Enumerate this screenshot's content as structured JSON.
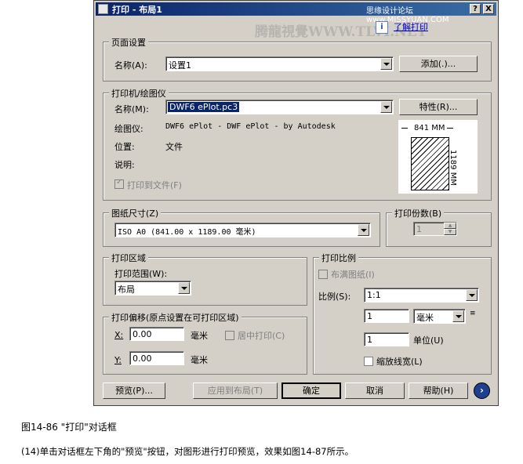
{
  "window": {
    "title": "打印 - 布局1",
    "watermark_top": "思缘设计论坛 www.MISSYUAN.COM",
    "watermark_mid": "腾龍視覺WWW.TLVI.NET",
    "help_button": "?",
    "close_button": "X",
    "learn_link": "了解打印"
  },
  "page_setup": {
    "group_label": "页面设置",
    "name_label": "名称(A):",
    "name_value": "设置1",
    "add_button": "添加(.)..."
  },
  "printer": {
    "group_label": "打印机/绘图仪",
    "name_label": "名称(M):",
    "name_value": "DWF6 ePlot.pc3",
    "properties_button": "特性(R)...",
    "plotter_label": "绘图仪:",
    "plotter_value": "DWF6 ePlot - DWF ePlot - by Autodesk",
    "location_label": "位置:",
    "location_value": "文件",
    "description_label": "说明:",
    "print_to_file_label": "打印到文件(F)",
    "preview_width": "841 MM",
    "preview_height": "1189 MM"
  },
  "paper": {
    "group_label": "图纸尺寸(Z)",
    "size_value": "ISO A0 (841.00 x 1189.00 毫米)"
  },
  "copies": {
    "group_label": "打印份数(B)",
    "value": "1"
  },
  "plot_area": {
    "group_label": "打印区域",
    "range_label": "打印范围(W):",
    "range_value": "布局"
  },
  "plot_scale": {
    "group_label": "打印比例",
    "fit_paper_label": "布满图纸(I)",
    "scale_label": "比例(S):",
    "scale_value": "1:1",
    "value1": "1",
    "unit1_value": "毫米",
    "value2": "1",
    "unit2_label": "单位(U)",
    "lineweight_label": "缩放线宽(L)"
  },
  "plot_offset": {
    "group_label": "打印偏移(原点设置在可打印区域)",
    "x_label": "X:",
    "x_value": "0.00",
    "x_unit": "毫米",
    "center_label": "居中打印(C)",
    "y_label": "Y:",
    "y_value": "0.00",
    "y_unit": "毫米"
  },
  "buttons": {
    "preview": "预览(P)...",
    "apply": "应用到布局(T)",
    "ok": "确定",
    "cancel": "取消",
    "help": "帮助(H)"
  },
  "page_text": {
    "figure_caption": "图14-86 \"打印\"对话框",
    "body_line": "(14)单击对话框左下角的\"预览\"按钮，对图形进行打印预览，效果如图14-87所示。"
  },
  "colors": {
    "dialog_bg": "#d4d0c8",
    "title_gradient_start": "#0a246a",
    "selection": "#0a246a",
    "link": "#0000cc"
  }
}
